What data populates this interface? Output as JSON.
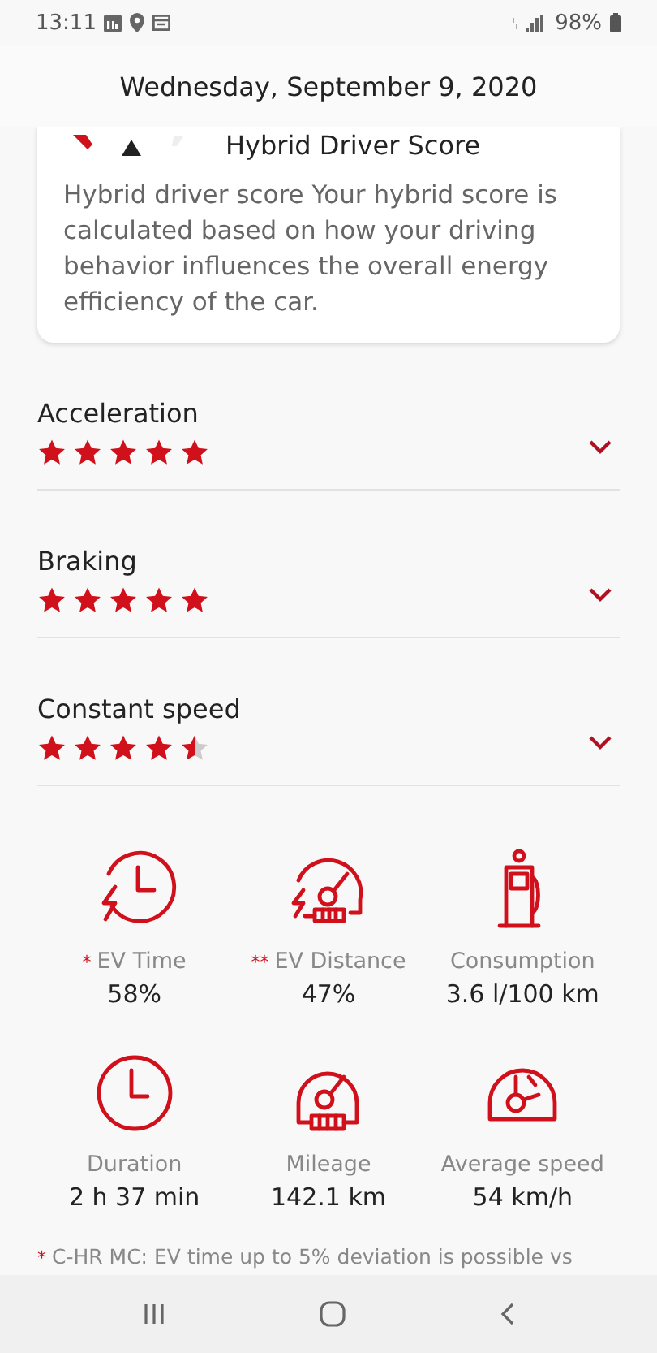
{
  "status_bar": {
    "time": "13:11",
    "battery": "98%"
  },
  "header": {
    "date": "Wednesday, September 9, 2020"
  },
  "score_card": {
    "title": "Hybrid Driver Score",
    "description": "Hybrid driver score Your hybrid score is calculated based on how your driving behavior influences the overall energy efficiency of the car."
  },
  "ratings": [
    {
      "label": "Acceleration",
      "stars": 5,
      "expanded": false
    },
    {
      "label": "Braking",
      "stars": 5,
      "expanded": false
    },
    {
      "label": "Constant speed",
      "stars": 4.5,
      "expanded": false
    }
  ],
  "stats": [
    {
      "kind": "ev-time",
      "marker": "*",
      "label": "EV Time",
      "value": "58%"
    },
    {
      "kind": "ev-distance",
      "marker": "**",
      "label": "EV Distance",
      "value": "47%"
    },
    {
      "kind": "consumption",
      "label": "Consumption",
      "value": "3.6 l/100 km"
    },
    {
      "kind": "duration",
      "label": "Duration",
      "value": "2 h 37 min"
    },
    {
      "kind": "mileage",
      "label": "Mileage",
      "value": "142.1 km"
    },
    {
      "kind": "average-speed",
      "label": "Average speed",
      "value": "54 km/h"
    }
  ],
  "footnote": {
    "marker": "*",
    "text": "C-HR MC: EV time up to 5% deviation is possible vs"
  }
}
